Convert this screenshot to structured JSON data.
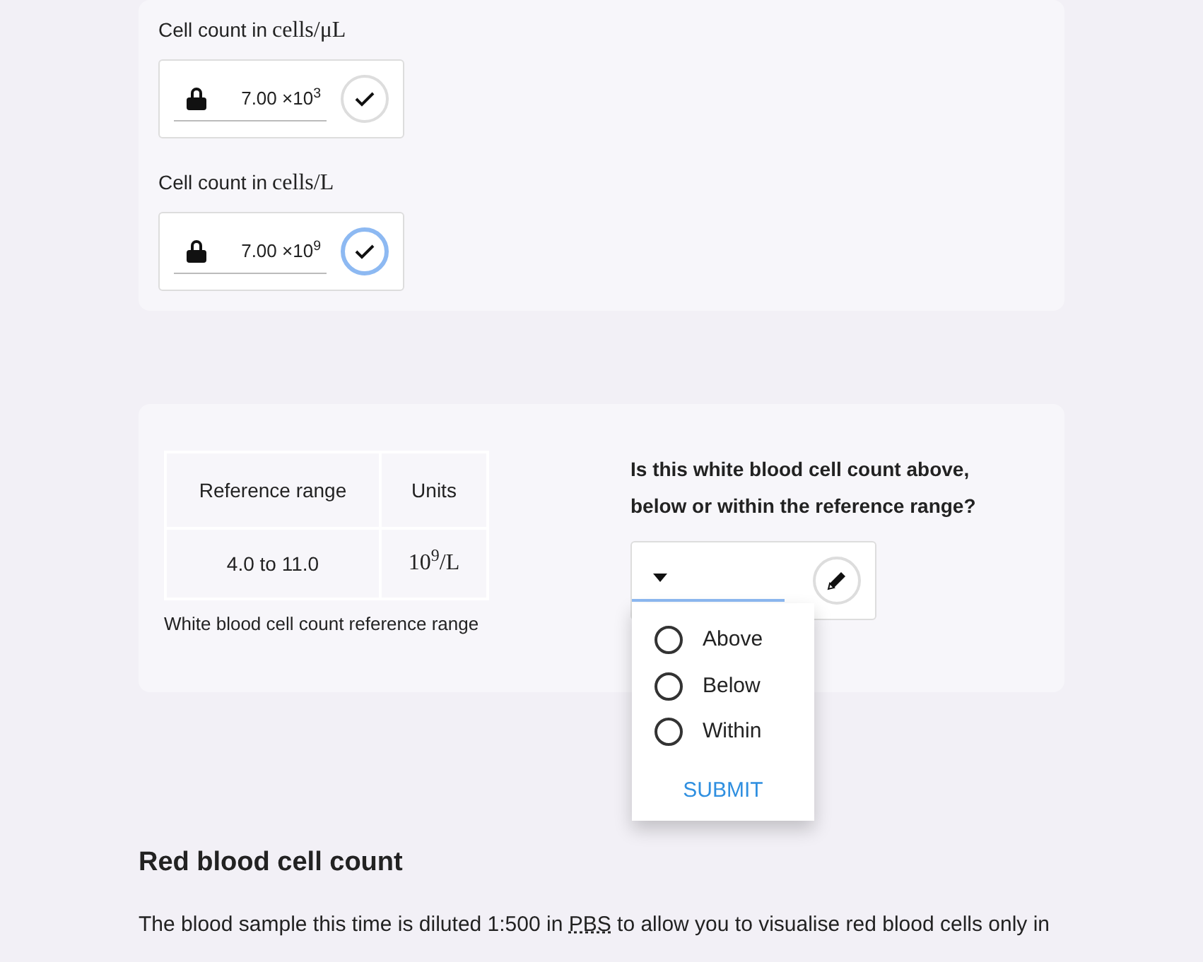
{
  "count_fields": [
    {
      "label": "Cell count in",
      "unit": "cells/μL",
      "value": "7.00 ×10$^{3}$",
      "locked": true,
      "focused": false
    },
    {
      "label": "Cell count in",
      "unit": "cells/L",
      "value": "7.00 ×10$^{9}$",
      "locked": true,
      "focused": true
    }
  ],
  "reference_table": {
    "columns": [
      "Reference range",
      "Units"
    ],
    "rows": [
      [
        "4.0 to 11.0",
        "10$^{9}$/L"
      ]
    ],
    "caption": "White blood cell count reference range"
  },
  "question": {
    "text": "Is this white blood cell count above, below or within the reference range?",
    "expanded": true,
    "options": [
      {
        "label": "Above",
        "selected": false
      },
      {
        "label": "Below",
        "selected": false
      },
      {
        "label": "Within",
        "selected": false
      }
    ],
    "submit": "SUBMIT"
  },
  "section": {
    "heading": "Red blood cell count",
    "paragraph_before": "The blood sample this time is diluted 1:500 in ",
    "abbr": "PBS",
    "paragraph_after": " to allow you to visualise red blood cells only in"
  }
}
